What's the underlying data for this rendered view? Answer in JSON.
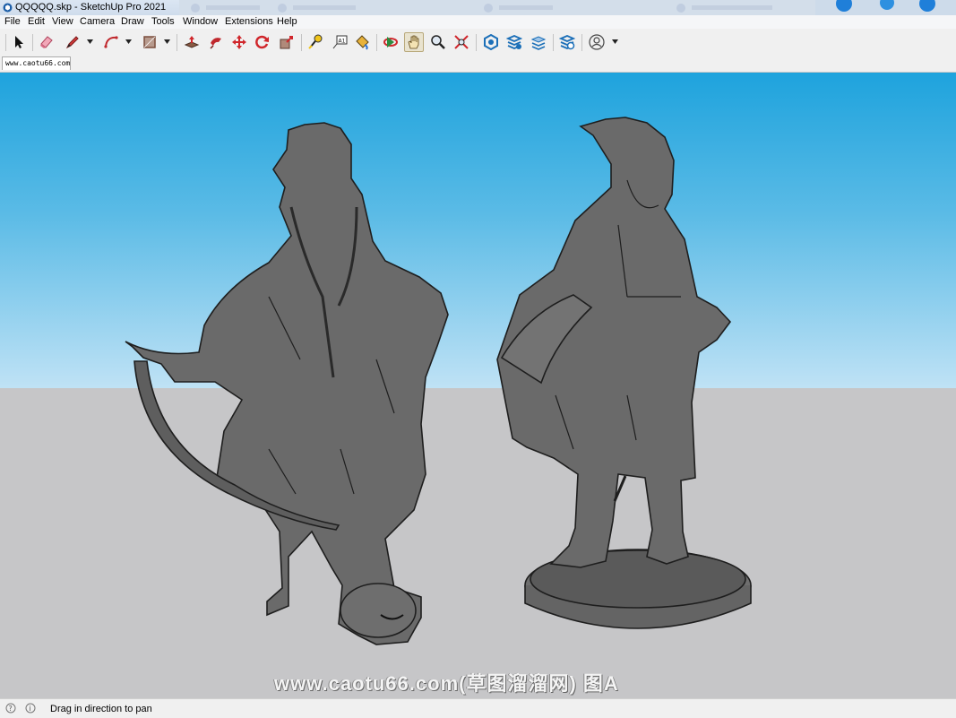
{
  "window": {
    "title": "QQQQQ.skp - SketchUp Pro 2021"
  },
  "menu": [
    "File",
    "Edit",
    "View",
    "Camera",
    "Draw",
    "Tools",
    "Window",
    "Extensions",
    "Help"
  ],
  "toolbar": {
    "tools": [
      {
        "name": "select-tool",
        "icon": "arrow-cursor-icon"
      },
      {
        "name": "eraser-tool",
        "icon": "eraser-icon"
      },
      {
        "name": "line-tool",
        "icon": "pencil-icon"
      },
      {
        "name": "arc-tool",
        "icon": "arc-icon"
      },
      {
        "name": "shape-tool",
        "icon": "rectangle-icon"
      },
      {
        "name": "push-pull-tool",
        "icon": "push-pull-icon"
      },
      {
        "name": "follow-me-tool",
        "icon": "follow-me-icon"
      },
      {
        "name": "move-tool",
        "icon": "move-icon"
      },
      {
        "name": "rotate-tool",
        "icon": "rotate-icon"
      },
      {
        "name": "scale-tool",
        "icon": "scale-icon"
      },
      {
        "name": "tape-measure-tool",
        "icon": "tape-measure-icon"
      },
      {
        "name": "text-tool",
        "icon": "text-icon"
      },
      {
        "name": "paint-bucket-tool",
        "icon": "paint-bucket-icon"
      },
      {
        "name": "orbit-tool",
        "icon": "orbit-icon"
      },
      {
        "name": "pan-tool",
        "icon": "hand-icon"
      },
      {
        "name": "zoom-tool",
        "icon": "magnifier-icon"
      },
      {
        "name": "zoom-extents-tool",
        "icon": "zoom-extents-icon"
      },
      {
        "name": "warehouse-button",
        "icon": "warehouse-icon"
      },
      {
        "name": "extension-warehouse-button",
        "icon": "extension-warehouse-icon"
      },
      {
        "name": "layout-button",
        "icon": "layout-icon"
      },
      {
        "name": "extension-manager-button",
        "icon": "extension-manager-icon"
      },
      {
        "name": "account-button",
        "icon": "user-icon"
      }
    ],
    "active_tool": "pan-tool"
  },
  "scene_tab": {
    "label": "www.caotu66.com"
  },
  "viewport": {
    "watermark": "www.caotu66.com(草图溜溜网) 图A",
    "colors": {
      "sky_top": "#1ea3dd",
      "sky_horizon": "#bfe2f5",
      "ground": "#c6c6c8",
      "model": "#6a6a6a"
    }
  },
  "status": {
    "text": "Drag in direction to pan"
  }
}
